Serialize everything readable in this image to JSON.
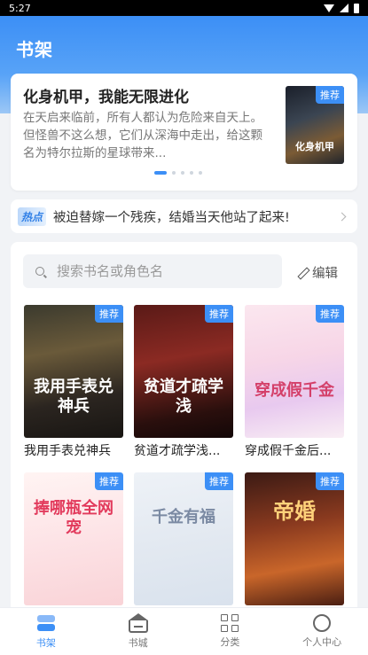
{
  "status_bar": {
    "time": "5:27"
  },
  "header": {
    "title": "书架"
  },
  "banner": {
    "title": "化身机甲，我能无限进化",
    "description": "在天启来临前，所有人都认为危险来自天上。 但怪兽不这么想，它们从深海中走出，给这颗名为特尔拉斯的星球带来...",
    "tag": "推荐",
    "cover_text": "化身机甲",
    "dots_total": 5,
    "dots_active_index": 0
  },
  "hot": {
    "tag": "热点",
    "text": "被迫替嫁一个残疾，结婚当天他站了起来!"
  },
  "search": {
    "placeholder": "搜索书名或角色名",
    "edit_label": "编辑"
  },
  "books": [
    {
      "title": "我用手表兑神兵",
      "cover_text": "我用手表兑神兵",
      "tag": "推荐"
    },
    {
      "title": "贫道才疏学浅...",
      "cover_text": "贫道才疏学浅",
      "tag": "推荐"
    },
    {
      "title": "穿成假千金后...",
      "cover_text": "穿成假千金",
      "tag": "推荐"
    },
    {
      "title": "",
      "cover_text": "捧哪瓶全网宠",
      "tag": "推荐"
    },
    {
      "title": "",
      "cover_text": "千金有福",
      "tag": "推荐"
    },
    {
      "title": "",
      "cover_text": "帝婚",
      "tag": "推荐"
    }
  ],
  "nav": {
    "items": [
      {
        "label": "书架",
        "icon": "bookshelf-icon",
        "active": true
      },
      {
        "label": "书城",
        "icon": "store-icon",
        "active": false
      },
      {
        "label": "分类",
        "icon": "category-icon",
        "active": false
      },
      {
        "label": "个人中心",
        "icon": "user-icon",
        "active": false
      }
    ]
  },
  "colors": {
    "accent": "#3c8ff6",
    "background": "#f1f3f6"
  }
}
